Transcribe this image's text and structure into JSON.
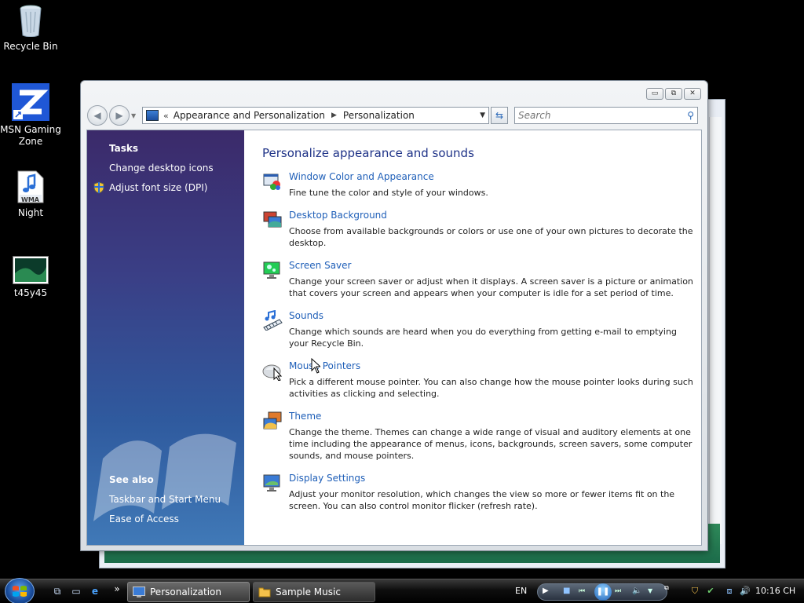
{
  "desktop": {
    "icons": [
      {
        "label": "Recycle Bin"
      },
      {
        "label": "MSN Gaming Zone"
      },
      {
        "label": "Night",
        "badge": "WMA"
      },
      {
        "label": "t45y45"
      }
    ]
  },
  "window": {
    "breadcrumb": [
      "Appearance and Personalization",
      "Personalization"
    ],
    "breadcrumb_prefix": "«",
    "search_placeholder": "Search",
    "caption": {
      "minimize": "▭",
      "maximize": "⧉",
      "close": "✕"
    }
  },
  "left_pane": {
    "tasks_heading": "Tasks",
    "tasks": [
      {
        "label": "Change desktop icons",
        "icon": "none"
      },
      {
        "label": "Adjust font size (DPI)",
        "icon": "shield-icon"
      }
    ],
    "see_also_heading": "See also",
    "see_also": [
      {
        "label": "Taskbar and Start Menu"
      },
      {
        "label": "Ease of Access"
      }
    ]
  },
  "content": {
    "title": "Personalize appearance and sounds",
    "items": [
      {
        "title": "Window Color and Appearance",
        "desc": "Fine tune the color and style of your windows.",
        "icon": "window-color-icon"
      },
      {
        "title": "Desktop Background",
        "desc": "Choose from available backgrounds or colors or use one of your own pictures to decorate the desktop.",
        "icon": "desktop-background-icon"
      },
      {
        "title": "Screen Saver",
        "desc": "Change your screen saver or adjust when it displays. A screen saver is a picture or animation that covers your screen and appears when your computer is idle for a set period of time.",
        "icon": "screen-saver-icon"
      },
      {
        "title": "Sounds",
        "desc": "Change which sounds are heard when you do everything from getting e-mail to emptying your Recycle Bin.",
        "icon": "sounds-icon"
      },
      {
        "title": "Mouse Pointers",
        "desc": "Pick a different mouse pointer. You can also change how the mouse pointer looks during such activities as clicking and selecting.",
        "icon": "mouse-pointers-icon"
      },
      {
        "title": "Theme",
        "desc": "Change the theme. Themes can change a wide range of visual and auditory elements at one time including the appearance of menus, icons, backgrounds, screen savers, some computer sounds, and mouse pointers.",
        "icon": "theme-icon"
      },
      {
        "title": "Display Settings",
        "desc": "Adjust your monitor resolution, which changes the view so more or fewer items fit on the screen. You can also control monitor flicker (refresh rate).",
        "icon": "display-settings-icon"
      }
    ]
  },
  "taskbar": {
    "quicklaunch_more": "»",
    "buttons": [
      {
        "label": "Personalization",
        "active": true
      },
      {
        "label": "Sample Music",
        "active": false
      }
    ],
    "language": "EN",
    "clock": "10:16 CH"
  },
  "colors": {
    "link": "#1f5fb8",
    "title": "#1e3287",
    "pane_top": "#3b2a6a",
    "pane_bottom": "#4079b7"
  }
}
